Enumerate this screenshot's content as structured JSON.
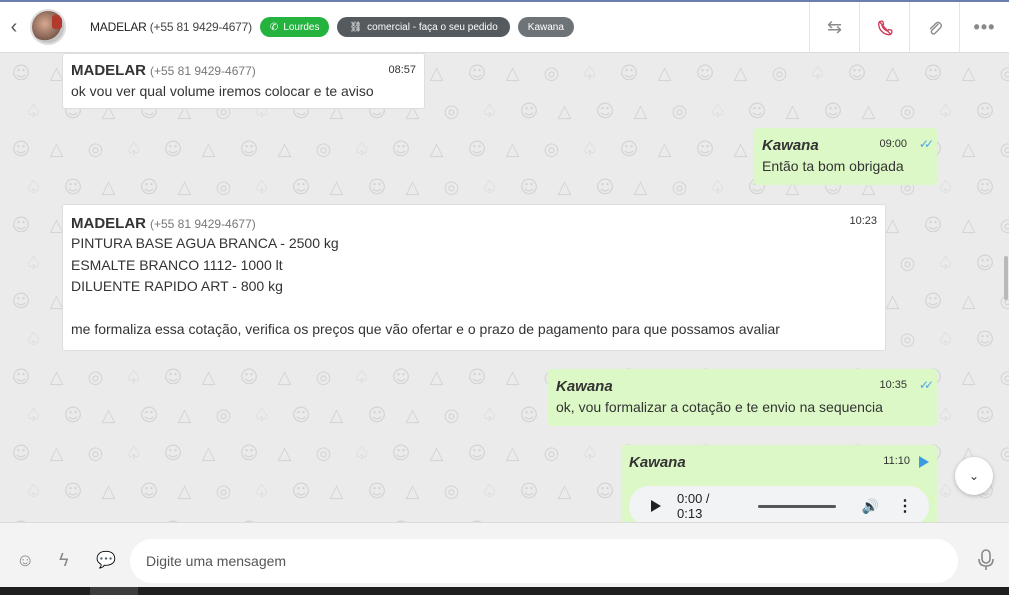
{
  "header": {
    "back_icon": "chevron-left-icon",
    "contact_name": "MADELAR",
    "contact_phone": "(+55 81 9429-4677)",
    "tags": [
      {
        "label": "Lourdes",
        "color": "#25b33f",
        "icon": "whatsapp-icon"
      },
      {
        "label": "comercial - faça o seu pedido",
        "color": "#555a5e",
        "icon": "sitemap-icon"
      },
      {
        "label": "Kawana",
        "color": "#6e7378"
      }
    ],
    "actions": [
      "transfer-icon",
      "end-call-icon",
      "attach-icon",
      "more-icon"
    ]
  },
  "messages": [
    {
      "direction": "in",
      "sender": "MADELAR",
      "phone": "(+55 81 9429-4677)",
      "time": "08:57",
      "text": "ok vou ver qual volume iremos colocar e te aviso"
    },
    {
      "direction": "out",
      "sender": "Kawana",
      "time": "09:00",
      "status": "read",
      "text": "Então ta bom obrigada"
    },
    {
      "direction": "in",
      "sender": "MADELAR",
      "phone": "(+55 81 9429-4677)",
      "time": "10:23",
      "text": "PINTURA BASE AGUA BRANCA - 2500 kg\nESMALTE BRANCO 1112- 1000 lt\nDILUENTE RAPIDO ART - 800 kg\n\nme formaliza essa cotação, verifica os preços que vão ofertar e o prazo de pagamento para que possamos avaliar"
    },
    {
      "direction": "out",
      "sender": "Kawana",
      "time": "10:35",
      "status": "read",
      "text": "ok, vou formalizar a cotação e te envio na sequencia"
    },
    {
      "direction": "out",
      "sender": "Kawana",
      "time": "11:10",
      "status": "audio",
      "audio": {
        "time": "0:00 / 0:13"
      }
    }
  ],
  "composer": {
    "placeholder": "Digite uma mensagem",
    "icons": [
      "emoji-icon",
      "lightning-icon",
      "chat-bubble-icon",
      "microphone-icon"
    ]
  }
}
